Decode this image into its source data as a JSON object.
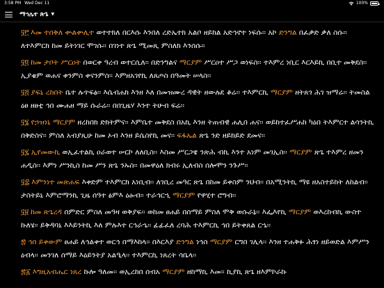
{
  "status_bar": {
    "time": "3:58 PM",
    "date": "Wed Dec 11",
    "battery_pct": "100%",
    "battery_fill": 1.0
  },
  "nav": {
    "menu_icon": "hamburger-menu-icon",
    "title": "ማኅሌተ ጽጌ",
    "caret_icon": "caret-down-icon"
  },
  "colors": {
    "accent": "#f29a38",
    "text": "#ffffff",
    "background": "#000000"
  },
  "verses": [
    {
      "num": "፶፫",
      "segments": [
        {
          "t": "እመ ተሰቅለ ቍልቍሊተ",
          "h": true
        },
        {
          "t": " ወተተክለ በርእሱ እንበለ ረድኤተክ አልቦ ዘይክል አድኅኖተ ነፍሱ፡፡ አኮ ",
          "h": false
        },
        {
          "t": "ድንግል",
          "h": true
        },
        {
          "t": " በፈቃድ ቃለ ስሱ፡፡ ለተእምርክ ከመ ይትነገር ሞገሱ፡፡ በገነተ ጽጌ ሚመጺ ምስለክ እንሰሱ፡፡",
          "h": false
        }
      ]
    },
    {
      "num": "፶፬",
      "segments": [
        {
          "t": "ከመ ታቦት ሥርዐት",
          "h": true
        },
        {
          "t": " በወርቀ ዓረብ ወተርሲለ፡፡ በድንግልና ",
          "h": false
        },
        {
          "t": "ማርያም",
          "h": true
        },
        {
          "t": " ሥርዐተ ሥጋ ወነፍስ፡፡ ተእምረ ነቢር እርእይኪ በቢተ መቅደስ፡፡ ኢያቄም ወሐና ቀንምስ ቀናንምስ፡፡ እምዘአገየኪ ለጸጦስ በዓመት ሠላስ፡፡",
          "h": false
        }
      ]
    },
    {
      "num": "፶፭",
      "segments": [
        {
          "t": "ያፍኒ ረከበት",
          "h": true
        },
        {
          "t": " ቤተ ሉጥፍፅ፡፡ እሴብሐክ እንዘ እለ በመዝሙረ ዳዊት ዘውሉደ ቆሬ፡፡ ተእምርኪ ",
          "h": false
        },
        {
          "t": "ማርያም",
          "h": true
        },
        {
          "t": " ዘትጸጎ ሕገ ዝማሬ፡፡ ትመስል ዕፀ ዘፀቲ ኅበ ሙሐዘ ማይ ሱራሬ፡፡ በበጊዜሃ እንተ ትሁብ ፍሬ፡፡",
          "h": false
        }
      ]
    },
    {
      "num": "፶፮",
      "segments": [
        {
          "t": "የኃዝነኒ ማርያም",
          "h": true
        },
        {
          "t": " ዘረከበክ ድክትምና፡፡ እምቤተ መቅደስ በአኪ እንዘ ትጠብዊ ሐሊበ ሐና፡፡ ወይከተፈሥሐከ ካዕበ ትእምርተ ልሳንትኪ በቅድስና፡፡ ምስለ አብያጺሁ ከመ ኦብ እንዘ ይሴስየኪ መና፡፡ ",
          "h": false
        },
        {
          "t": "ፍፋኤል",
          "h": true
        },
        {
          "t": " ጽጌ ንድ ዘይክይድ ደመና፡፡",
          "h": false
        }
      ]
    },
    {
      "num": "፶፯",
      "segments": [
        {
          "t": "ኢየመውኪ",
          "h": true
        },
        {
          "t": " ወኢፈተልኪ ዐራወተ ሠርኮ ለለቢስ፡፡ እስመ ሥርጋዌ ንጽሕ ብኪ እንተ አነም መገኢስ፡፡ ",
          "h": false
        },
        {
          "t": "ማርያም",
          "h": true
        },
        {
          "t": " ጽጌ ተእምረ ዘመን ሐዲስ፡፡ እምነ ሥንኪስ ከመ ሥን ጽጌ ንኡስ፡፡ በመዋዕለ ክብሩ ኢለብስ ሰሎሞን ንጉሥ፡፡",
          "h": false
        }
      ]
    },
    {
      "num": "፶፰",
      "segments": [
        {
          "t": "እምንነተ መጽሐፍ",
          "h": true
        },
        {
          "t": " እቀድም ተእምርክ አነቢብ፡፡ ለገቢረ መዓር ጽጌ በከመ ይቀስም ንህብ፡፡ በአሚንትኪ ማዩ ዘአስተይከት ለከልብ፡፡ ታስትይኒ እምሮማንኪ ጊዜ ሰዓተ ፅምእ ዕፁብ፡፡ ተራኅርኂ ",
          "h": false
        },
        {
          "t": "ማርያም",
          "h": true
        },
        {
          "t": " የዋሂተ ሮግብ፡፡",
          "h": false
        }
      ]
    },
    {
      "num": "፶፱",
      "segments": [
        {
          "t": "ከመ ጽጌረዳ",
          "h": true
        },
        {
          "t": " በምድር ምስለ መዓዛ ወቅያፍ፡፡ ወከመ ፀሐይ በሰማይ ምስለ ሞቅ ወሱራኔ፡፡ እፌእየኪ ",
          "h": false
        },
        {
          "t": "ማርያም",
          "h": true
        },
        {
          "t": " ወእረከብኪ ውስተ ኩለሄ፡፡ ይቅዳባኒ እእይንትኪ እለ ምሉእተ ርኅራኄ፡፡ ፊፊፈለ ረባሕ ተእምርኪ ኅበ ይትቀጸል ርኄ፡፡",
          "h": false
        }
      ]
    },
    {
      "num": "፷",
      "segments": [
        {
          "t": "ኅበ ይቀውም",
          "h": true
        },
        {
          "t": " ፀሐይ ለኅልቀተ ወርኅ በማእከላ፡፡ በእርእያ ",
          "h": false
        },
        {
          "t": "ድንግል",
          "h": true
        },
        {
          "t": " ነኅስ ",
          "h": false
        },
        {
          "t": "ማርያም",
          "h": true
        },
        {
          "t": " ርግበ ገሊላ፡፡ እንዘ ተሐቅፉ ሕፃነ ዘይወድል እምሥን ዕብላ፡፡ መንገለ ሰማይ እዕይንትያ አልዒላ፡፡ ተእምርኪ ነጸረት ሳቤላ፡፡",
          "h": false
        }
      ]
    },
    {
      "num": "፷፩",
      "segments": [
        {
          "t": "እግዚአብሔር ነጸረ",
          "h": true
        },
        {
          "t": " ኩሎ ዓለመ፡፡ ወኢረከበ ሰብአ ",
          "h": false
        },
        {
          "t": "ማርያም",
          "h": true
        },
        {
          "t": " ዘከማኪ እመ፡፡ ኪያኪ ጽጌ ዘእምኮራኩ",
          "h": false
        }
      ]
    }
  ]
}
